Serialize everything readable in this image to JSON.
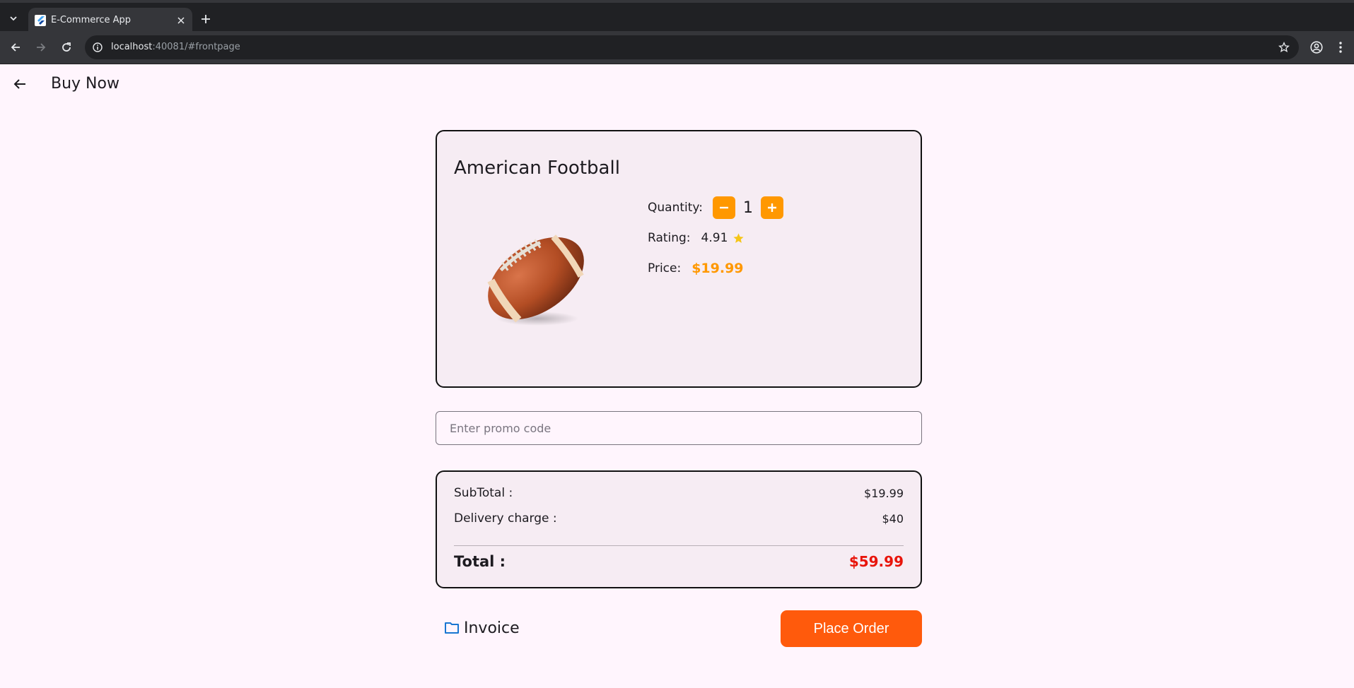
{
  "browser": {
    "tab_title": "E-Commerce App",
    "url_host": "localhost",
    "url_rest": ":40081/#frontpage"
  },
  "appbar": {
    "title": "Buy Now"
  },
  "product": {
    "name": "American Football",
    "quantity_label": "Quantity:",
    "quantity": "1",
    "rating_label": "Rating:",
    "rating": "4.91",
    "price_label": "Price:",
    "price": "$19.99"
  },
  "promo": {
    "placeholder": "Enter promo code",
    "value": ""
  },
  "summary": {
    "subtotal_label": "SubTotal :",
    "subtotal": "$19.99",
    "delivery_label": "Delivery charge :",
    "delivery": "$40",
    "total_label": "Total :",
    "total": "$59.99"
  },
  "actions": {
    "invoice_label": "Invoice",
    "place_order_label": "Place Order"
  },
  "colors": {
    "accent": "#ff9800",
    "place_order": "#ff5a0c",
    "total": "#e8150b",
    "background": "#fff5fd",
    "card": "#f6ecf3",
    "invoice_icon": "#1976d2",
    "star": "#f5c518"
  }
}
